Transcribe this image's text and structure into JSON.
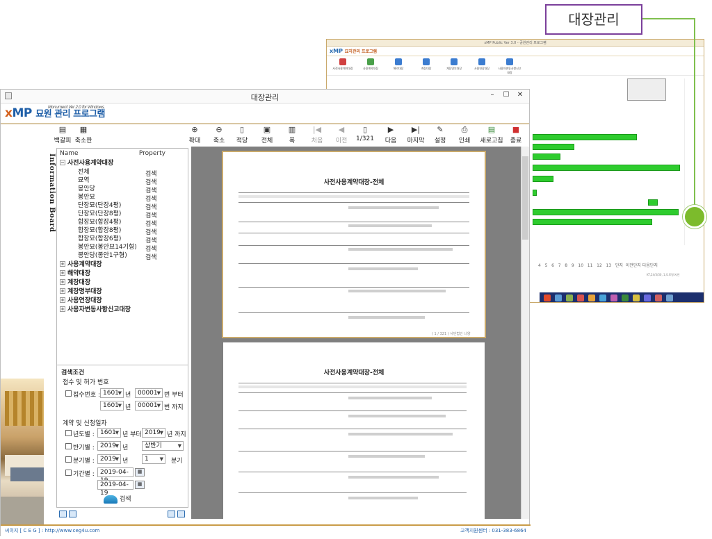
{
  "callout": {
    "label": "대장관리"
  },
  "background_window": {
    "title": "xMP Public Ver 3.0 - 공원관리 프로그램",
    "logo": "xMP",
    "logo_sub": "묘지관리 프로그램",
    "toolbar": [
      "사전사용계약대장",
      "사용계약대장",
      "해약대장",
      "계장대장",
      "계장명부대장",
      "사용연장대장",
      "사용자변동사항신고대장"
    ],
    "pager": {
      "pages": [
        "4",
        "5",
        "6",
        "7",
        "8",
        "9",
        "10",
        "11",
        "12",
        "13"
      ],
      "unit": "단지",
      "prev": "이전단지",
      "next": "다음단지"
    },
    "footnote": "KT,24/3/30, 1,도로명/지번"
  },
  "window": {
    "title": "대장관리",
    "minimize": "–",
    "maximize": "☐",
    "close": "✕"
  },
  "logo": {
    "x": "x",
    "mp": "MP",
    "subtitle": "묘원 관리 프로그램",
    "version": "Monument Ver 2.0 for Windows"
  },
  "toolbar": [
    {
      "label": "백갈피",
      "icon": "bookmark-back-icon"
    },
    {
      "label": "축소판",
      "icon": "thumbnail-icon"
    },
    {
      "label": "확대",
      "icon": "zoom-in-icon"
    },
    {
      "label": "축소",
      "icon": "zoom-out-icon"
    },
    {
      "label": "적당",
      "icon": "fit-page-icon"
    },
    {
      "label": "전체",
      "icon": "whole-page-icon"
    },
    {
      "label": "폭",
      "icon": "fit-width-icon"
    },
    {
      "label": "처음",
      "icon": "first-page-icon"
    },
    {
      "label": "이전",
      "icon": "prev-page-icon"
    },
    {
      "label": "1/321",
      "icon": "page-icon"
    },
    {
      "label": "다음",
      "icon": "next-page-icon"
    },
    {
      "label": "마지막",
      "icon": "last-page-icon"
    },
    {
      "label": "설정",
      "icon": "settings-icon"
    },
    {
      "label": "인쇄",
      "icon": "print-icon"
    },
    {
      "label": "새로고침",
      "icon": "refresh-icon"
    },
    {
      "label": "종료",
      "icon": "exit-icon"
    }
  ],
  "info_board": "Information Board",
  "tree": {
    "header": {
      "name": "Name",
      "property": "Property"
    },
    "root": "사전사용계약대장",
    "children": [
      {
        "label": "전체",
        "prop": "검색"
      },
      {
        "label": "묘역",
        "prop": "검색"
      },
      {
        "label": "봉안당",
        "prop": "검색"
      },
      {
        "label": "봉안묘",
        "prop": "검색"
      },
      {
        "label": "단장묘(단장4평)",
        "prop": "검색"
      },
      {
        "label": "단장묘(단장8평)",
        "prop": "검색"
      },
      {
        "label": "합장묘(합장4평)",
        "prop": "검색"
      },
      {
        "label": "합장묘(합장8평)",
        "prop": "검색"
      },
      {
        "label": "합장묘(합장6평)",
        "prop": "검색"
      },
      {
        "label": "봉안묘(봉안묘14기형)",
        "prop": "검색"
      },
      {
        "label": "봉안당(봉안1구형)",
        "prop": "검색"
      }
    ],
    "groups": [
      "사용계약대장",
      "해약대장",
      "계장대장",
      "계장명부대장",
      "사용연장대장",
      "사용자변동사항신고대장"
    ]
  },
  "search": {
    "title": "검색조건",
    "sec1": "접수 및 허가 번호",
    "chk1": "접수번호 :",
    "r1": {
      "v1": "1601",
      "u1": "년",
      "v2": "00001",
      "u2": "번 부터"
    },
    "r2": {
      "v1": "1601",
      "u1": "년",
      "v2": "00001",
      "u2": "번 까지"
    },
    "sec2": "계약 및 신청일자",
    "chk2": "년도별 :",
    "r3": {
      "v1": "1601",
      "u1": "년 부터",
      "v2": "2019",
      "u2": "년 까지"
    },
    "chk3": "반기별 :",
    "r4": {
      "v1": "2019",
      "u1": "년",
      "v2": "상반기"
    },
    "chk4": "분기별 :",
    "r5": {
      "v1": "2019",
      "u1": "년",
      "v2": "1",
      "u2": "분기"
    },
    "chk5": "기간별 :",
    "d1": "2019-04-19",
    "d2": "2019-04-19",
    "button": "검색"
  },
  "pages": [
    {
      "title": "사전사용계약대장-전체"
    },
    {
      "title": "사전사용계약대장-전체"
    }
  ],
  "page_footer": "( 1 / 321 ) 사단법인 나양",
  "status": {
    "left": "씨이지 [ C E G ] : http://www.ceg4u.com",
    "right": "고객지원센터 : 031-383-6864"
  }
}
